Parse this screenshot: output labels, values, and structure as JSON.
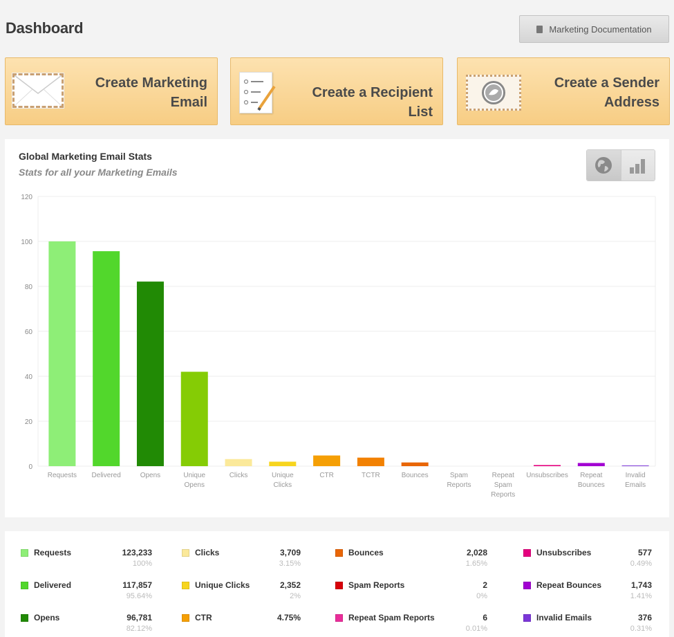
{
  "header": {
    "title": "Dashboard",
    "doc_button_label": "Marketing Documentation"
  },
  "actions": {
    "create_email": [
      "Create Marketing",
      "Email"
    ],
    "create_list": [
      "Create a Recipient",
      "List"
    ],
    "create_sender": [
      "Create a Sender",
      "Address"
    ]
  },
  "stats": {
    "title": "Global Marketing Email Stats",
    "subtitle": "Stats for all your Marketing Emails",
    "toggle_icons": [
      "globe-icon",
      "bar-chart-icon"
    ]
  },
  "chart_data": {
    "type": "bar",
    "categories": [
      [
        "Requests"
      ],
      [
        "Delivered"
      ],
      [
        "Opens"
      ],
      [
        "Unique",
        "Opens"
      ],
      [
        "Clicks"
      ],
      [
        "Unique",
        "Clicks"
      ],
      [
        "CTR"
      ],
      [
        "TCTR"
      ],
      [
        "Bounces"
      ],
      [
        "Spam",
        "Reports"
      ],
      [
        "Repeat",
        "Spam",
        "Reports"
      ],
      [
        "Unsubscribes"
      ],
      [
        "Repeat",
        "Bounces"
      ],
      [
        "Invalid",
        "Emails"
      ]
    ],
    "values": [
      100,
      95.64,
      82.12,
      42,
      3.15,
      2,
      4.75,
      3.8,
      1.65,
      0,
      0,
      0.49,
      1.41,
      0.31
    ],
    "colors": [
      "#8eee77",
      "#52d72c",
      "#218a05",
      "#85cc05",
      "#fbe99a",
      "#f7d51e",
      "#f59f05",
      "#f28102",
      "#e96607",
      "#d8000a",
      "#ea2d9a",
      "#e5007e",
      "#a200d2",
      "#7b36d8"
    ],
    "ylim": [
      0,
      120
    ],
    "yticks": [
      0,
      20,
      40,
      60,
      80,
      100,
      120
    ],
    "grid": true,
    "legend": "none"
  },
  "legend": [
    [
      {
        "name": "Requests",
        "value": "123,233",
        "pct": "100%",
        "color": "#8eee77"
      },
      {
        "name": "Delivered",
        "value": "117,857",
        "pct": "95.64%",
        "color": "#52d72c"
      },
      {
        "name": "Opens",
        "value": "96,781",
        "pct": "82.12%",
        "color": "#218a05"
      }
    ],
    [
      {
        "name": "Clicks",
        "value": "3,709",
        "pct": "3.15%",
        "color": "#fbe99a"
      },
      {
        "name": "Unique Clicks",
        "value": "2,352",
        "pct": "2%",
        "color": "#f7d51e"
      },
      {
        "name": "CTR",
        "value": "4.75%",
        "pct": "",
        "color": "#f59f05"
      }
    ],
    [
      {
        "name": "Bounces",
        "value": "2,028",
        "pct": "1.65%",
        "color": "#e96607"
      },
      {
        "name": "Spam Reports",
        "value": "2",
        "pct": "0%",
        "color": "#d8000a"
      },
      {
        "name": "Repeat Spam Reports",
        "value": "6",
        "pct": "0.01%",
        "color": "#ea2d9a"
      }
    ],
    [
      {
        "name": "Unsubscribes",
        "value": "577",
        "pct": "0.49%",
        "color": "#e5007e"
      },
      {
        "name": "Repeat Bounces",
        "value": "1,743",
        "pct": "1.41%",
        "color": "#a200d2"
      },
      {
        "name": "Invalid Emails",
        "value": "376",
        "pct": "0.31%",
        "color": "#7b36d8"
      }
    ]
  ]
}
